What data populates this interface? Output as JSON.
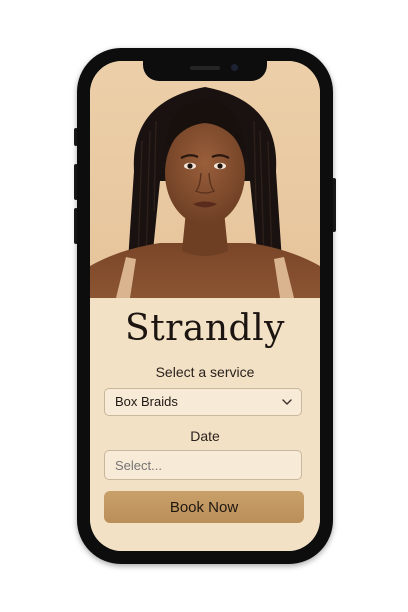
{
  "app": {
    "name": "Strandly"
  },
  "booking": {
    "service_label": "Select a service",
    "service_value": "Box Braids",
    "date_label": "Date",
    "date_placeholder": "Select...",
    "submit_label": "Book Now"
  },
  "hero": {
    "image": "portrait-woman-box-braids"
  },
  "icons": {
    "service_dropdown": "chevron-down-icon"
  },
  "colors": {
    "accent": "#c49a63",
    "panel": "#f3e1c6",
    "field": "#f7ead6",
    "text": "#1b1410"
  }
}
